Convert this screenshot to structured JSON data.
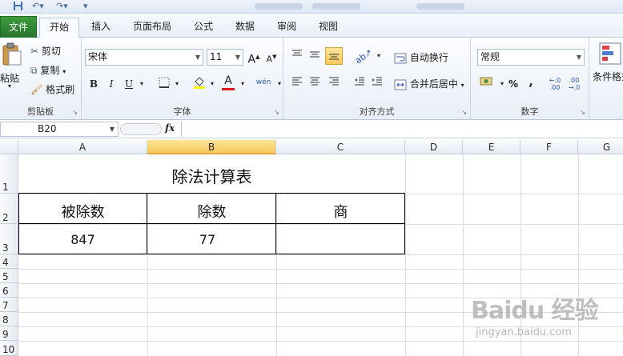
{
  "ribbon_tabs": {
    "file": "文件",
    "home": "开始",
    "insert": "插入",
    "page_layout": "页面布局",
    "formulas": "公式",
    "data": "数据",
    "review": "审阅",
    "view": "视图"
  },
  "clipboard": {
    "paste": "粘贴",
    "cut": "剪切",
    "copy": "复制",
    "format_painter": "格式刷",
    "label": "剪贴板"
  },
  "font": {
    "name": "宋体",
    "size": "11",
    "label": "字体",
    "bold": "B",
    "italic": "I",
    "underline": "U",
    "grow": "A",
    "shrink": "A",
    "font_color": "A",
    "phonetic": "wén"
  },
  "alignment": {
    "wrap_text": "自动换行",
    "merge_center": "合并后居中",
    "label": "对齐方式"
  },
  "number": {
    "format": "常规",
    "percent": "%",
    "comma": ",",
    "label": "数字",
    "inc_decimal": "←.0 .00",
    "dec_decimal": ".00 →.0"
  },
  "styles": {
    "conditional": "条件格式"
  },
  "formula_bar": {
    "cell_ref": "B20",
    "fx": "fx",
    "value": ""
  },
  "columns": [
    "A",
    "B",
    "C",
    "D",
    "E",
    "F",
    "G"
  ],
  "rows": [
    "1",
    "2",
    "3",
    "4",
    "5",
    "6",
    "7",
    "8",
    "9",
    "10"
  ],
  "sheet": {
    "title": "除法计算表",
    "header_dividend": "被除数",
    "header_divisor": "除数",
    "header_quotient": "商",
    "dividend": "847",
    "divisor": "77",
    "quotient": ""
  },
  "watermark": {
    "brand": "Baidu 经验",
    "url": "jingyan.baidu.com"
  },
  "colors": {
    "file_tab": "#2f8a33",
    "selected_column": "#f7c95c",
    "ribbon_bg": "#e9eff7"
  }
}
